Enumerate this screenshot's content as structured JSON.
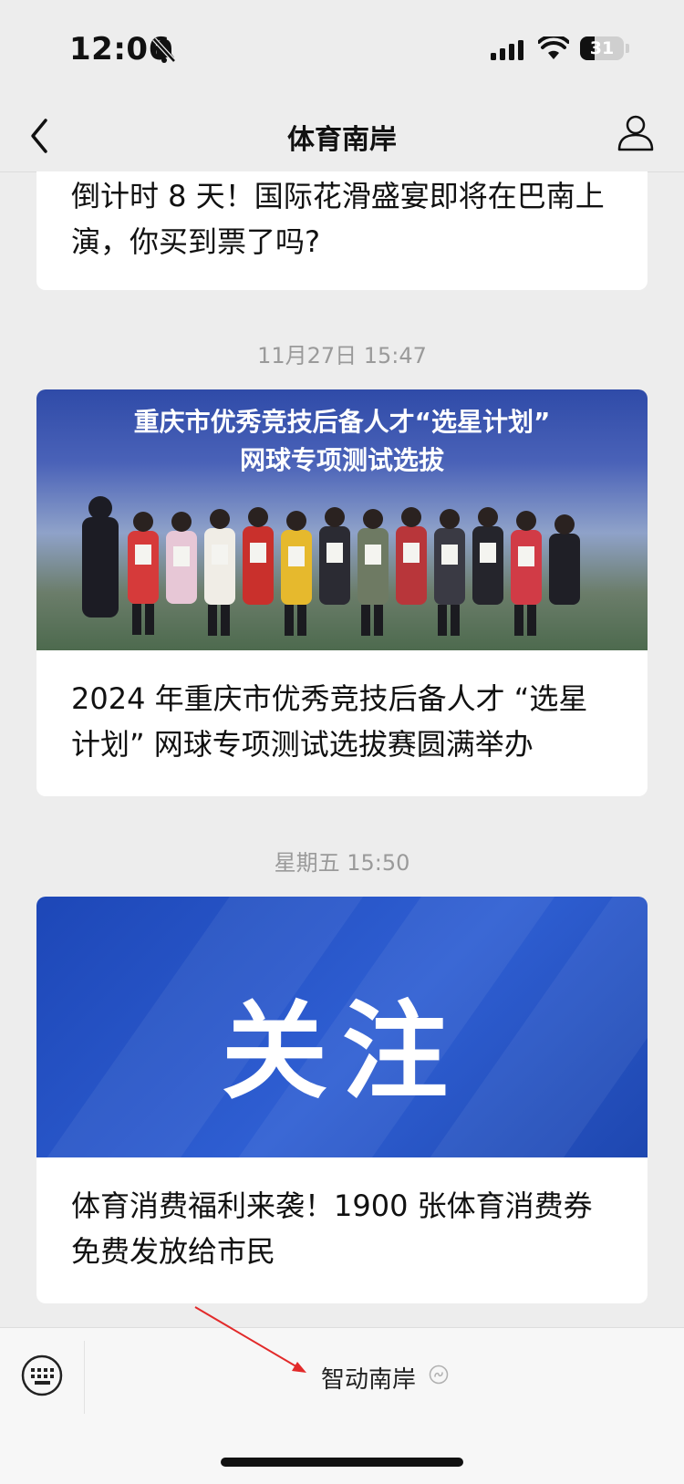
{
  "status_bar": {
    "time": "12:06",
    "battery": "31"
  },
  "nav": {
    "title": "体育南岸"
  },
  "feed": {
    "card1": {
      "title": "倒计时 8 天！国际花滑盛宴即将在巴南上演，你买到票了吗?"
    },
    "timestamp1": "11月27日 15:47",
    "card2": {
      "banner_line1": "重庆市优秀竞技后备人才“选星计划”",
      "banner_line2": "网球专项测试选拔",
      "title": "2024 年重庆市优秀竞技后备人才 “选星计划” 网球专项测试选拔赛圆满举办"
    },
    "timestamp2": "星期五 15:50",
    "card3": {
      "cover_text": "关注",
      "title": "体育消费福利来袭！1900 张体育消费券免费发放给市民"
    }
  },
  "bottom_menu": {
    "item_label": "智动南岸"
  },
  "icons": [
    "bell-muted-icon",
    "signal-icon",
    "wifi-icon",
    "battery-icon",
    "back-chevron-icon",
    "profile-icon",
    "keyboard-icon",
    "mini-program-icon"
  ]
}
